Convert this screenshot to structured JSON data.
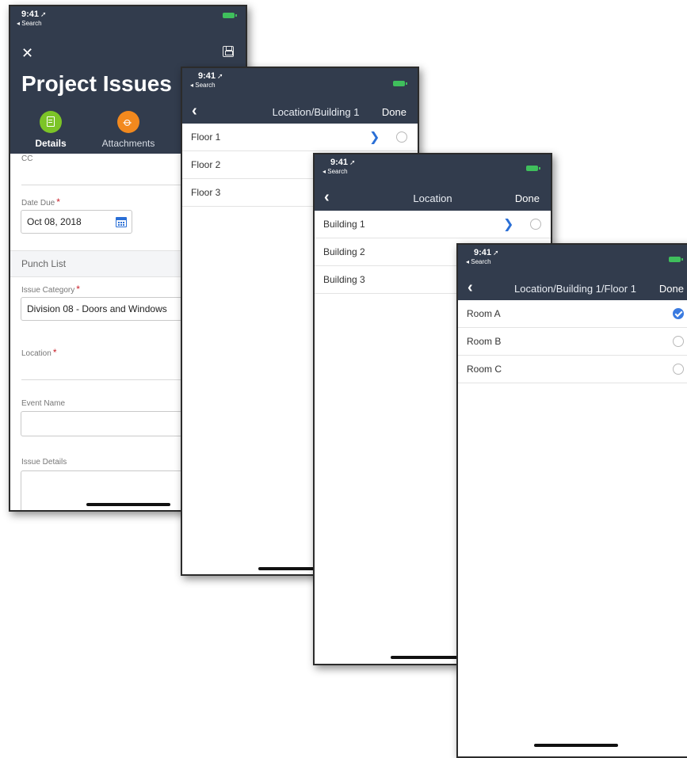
{
  "status": {
    "time": "9:41",
    "back": "◂ Search"
  },
  "issue_form": {
    "title": "Project Issues",
    "tabs": [
      {
        "label": "Details",
        "color": "#7cc427"
      },
      {
        "label": "Attachments",
        "color": "#f2891e"
      }
    ],
    "cc_label": "CC",
    "date_due_label": "Date Due",
    "date_due_value": "Oct 08, 2018",
    "section_label": "Punch List",
    "issue_category_label": "Issue Category",
    "issue_category_value": "Division 08 - Doors and Windows",
    "location_label": "Location",
    "event_name_label": "Event Name",
    "issue_details_label": "Issue Details",
    "required_mark": "*"
  },
  "floor_picker": {
    "title": "Location/Building 1",
    "done": "Done",
    "items": [
      "Floor 1",
      "Floor 2",
      "Floor 3"
    ]
  },
  "building_picker": {
    "title": "Location",
    "done": "Done",
    "items": [
      "Building 1",
      "Building 2",
      "Building 3"
    ]
  },
  "room_picker": {
    "title": "Location/Building 1/Floor 1",
    "done": "Done",
    "items": [
      "Room A",
      "Room B",
      "Room C"
    ],
    "selected": "Room A"
  }
}
